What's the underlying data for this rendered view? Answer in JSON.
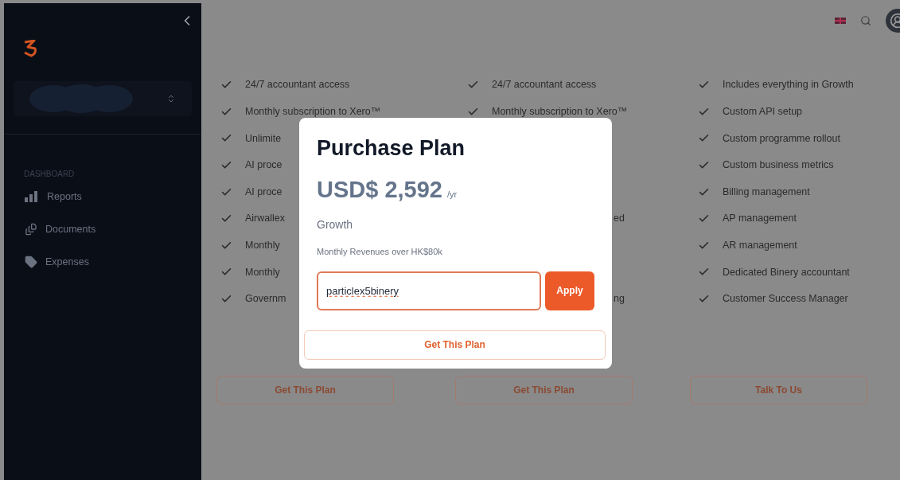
{
  "sidebar": {
    "section_label": "DASHBOARD",
    "items": [
      {
        "label": "Reports"
      },
      {
        "label": "Documents"
      },
      {
        "label": "Expenses"
      }
    ]
  },
  "plans": [
    {
      "features": [
        {
          "kind": "full",
          "text": "24/7 accountant access"
        },
        {
          "kind": "full",
          "text": "Monthly subscription to Xero™"
        },
        {
          "kind": "full",
          "text": "Unlimite"
        },
        {
          "kind": "full",
          "text": "AI proce"
        },
        {
          "kind": "full",
          "text": "AI proce"
        },
        {
          "kind": "full",
          "text": "Airwallex"
        },
        {
          "kind": "full",
          "text": "Monthly"
        },
        {
          "kind": "full",
          "text": "Monthly"
        },
        {
          "kind": "full",
          "text": "Governm"
        }
      ],
      "button": "Get This Plan"
    },
    {
      "features": [
        {
          "kind": "full",
          "text": "24/7 accountant access"
        },
        {
          "kind": "full",
          "text": "Monthly subscription to Xero™"
        },
        {
          "kind": "hidden"
        },
        {
          "kind": "hidden"
        },
        {
          "kind": "hidden"
        },
        {
          "kind": "tail",
          "text": "ed"
        },
        {
          "kind": "hidden"
        },
        {
          "kind": "hidden"
        },
        {
          "kind": "tail",
          "text": "ng"
        }
      ],
      "button": "Get This Plan"
    },
    {
      "features": [
        {
          "kind": "full",
          "text": "Includes everything in Growth"
        },
        {
          "kind": "full",
          "text": "Custom API setup"
        },
        {
          "kind": "full",
          "text": "Custom programme rollout"
        },
        {
          "kind": "full",
          "text": "Custom business metrics"
        },
        {
          "kind": "full",
          "text": "Billing management"
        },
        {
          "kind": "full",
          "text": "AP management"
        },
        {
          "kind": "full",
          "text": "AR management"
        },
        {
          "kind": "full",
          "text": "Dedicated Binery accountant"
        },
        {
          "kind": "full",
          "text": "Customer Success Manager"
        }
      ],
      "button": "Talk To Us"
    }
  ],
  "modal": {
    "title": "Purchase Plan",
    "price": "USD$ 2,592",
    "period": "/yr",
    "plan_name": "Growth",
    "description": "Monthly Revenues over HK$80k",
    "coupon": {
      "value": "particlex5binery"
    },
    "apply_button": "Apply",
    "submit_button": "Get This Plan"
  }
}
